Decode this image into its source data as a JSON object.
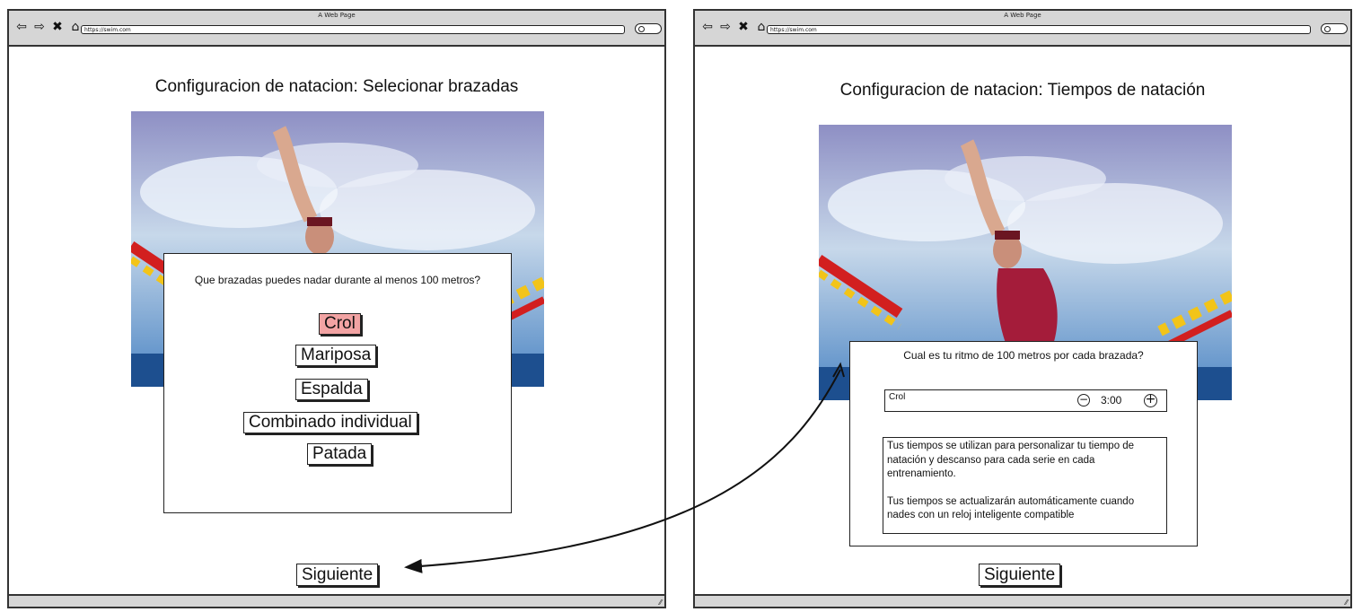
{
  "left_window": {
    "window_title": "A Web Page",
    "url": "https://swim.com",
    "page_title": "Configuracion de natacion: Selecionar brazadas",
    "question": "Que brazadas puedes nadar durante al menos 100 metros?",
    "strokes": [
      {
        "label": "Crol",
        "selected": true
      },
      {
        "label": "Mariposa",
        "selected": false
      },
      {
        "label": "Espalda",
        "selected": false
      },
      {
        "label": "Combinado individual",
        "selected": false
      },
      {
        "label": "Patada",
        "selected": false
      }
    ],
    "next_label": "Siguiente"
  },
  "right_window": {
    "window_title": "A Web Page",
    "url": "https://swim.com",
    "page_title": "Configuracion de natacion: Tiempos de natación",
    "question": "Cual es tu ritmo de 100 metros por cada brazada?",
    "pace": {
      "stroke": "Crol",
      "value": "3:00"
    },
    "info_paragraphs": [
      "Tus tiempos se utilizan para personalizar tu tiempo de natación y descanso para cada serie en cada entrenamiento.",
      "Tus tiempos se actualizarán automáticamente cuando nades con un reloj inteligente compatible"
    ],
    "next_label": "Siguiente"
  },
  "colors": {
    "selected_option": "#f2a3a3",
    "chrome_gray": "#d6d6d6",
    "outline": "#222222"
  },
  "icons": {
    "back": "arrow-left-icon",
    "forward": "arrow-right-icon",
    "close": "close-icon",
    "home": "home-icon",
    "search": "search-icon",
    "decrement": "minus-circle-icon",
    "increment": "plus-circle-icon"
  }
}
